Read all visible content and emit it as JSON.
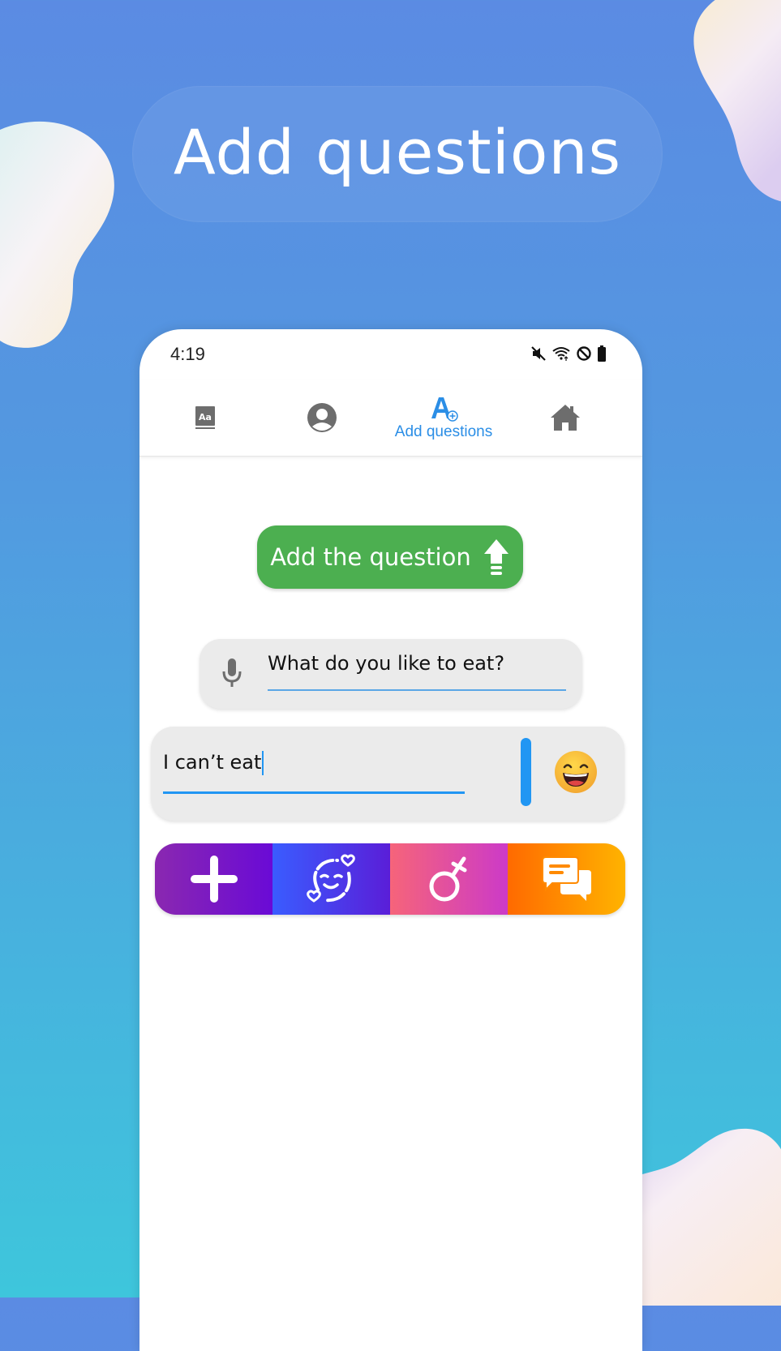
{
  "hero": {
    "title": "Add questions"
  },
  "status_bar": {
    "time": "4:19",
    "icons": [
      "mute-icon",
      "wifi-icon",
      "do-not-disturb-icon",
      "battery-icon"
    ]
  },
  "nav": {
    "items": [
      {
        "icon": "dictionary-icon",
        "label": ""
      },
      {
        "icon": "profile-icon",
        "label": ""
      },
      {
        "icon": "add-text-icon",
        "label": "Add questions",
        "active": true
      },
      {
        "icon": "home-icon",
        "label": ""
      }
    ]
  },
  "add_button": {
    "label": "Add the question",
    "icon": "upload-arrow-icon",
    "color": "#4caf50"
  },
  "question": {
    "icon": "microphone-icon",
    "value": "What do you like to eat?"
  },
  "answer": {
    "value": "I can’t eat",
    "emoji": "grinning-face-icon"
  },
  "toolbar": {
    "items": [
      {
        "icon": "plus-icon"
      },
      {
        "icon": "love-face-icon"
      },
      {
        "icon": "gender-icon"
      },
      {
        "icon": "chat-bubbles-icon"
      }
    ]
  },
  "colors": {
    "accent": "#2196f3",
    "active_tab": "#2b8ee6"
  }
}
